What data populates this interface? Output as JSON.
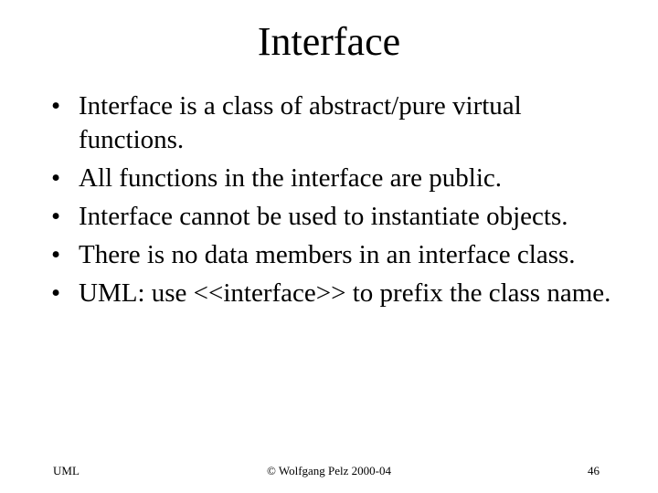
{
  "slide": {
    "title": "Interface",
    "bullets": [
      {
        "marker": "•",
        "text": "Interface is a class of abstract/pure virtual functions."
      },
      {
        "marker": "•",
        "text": "All functions in the interface are public."
      },
      {
        "marker": "•",
        "text": "Interface cannot be used to instantiate objects."
      },
      {
        "marker": "•",
        "text": "There is no data members in an interface class."
      },
      {
        "marker": "•",
        "text": "UML: use <<interface>> to prefix the class name."
      }
    ],
    "footer": {
      "left": "UML",
      "center": "© Wolfgang Pelz 2000-04",
      "page_number": "46"
    }
  }
}
